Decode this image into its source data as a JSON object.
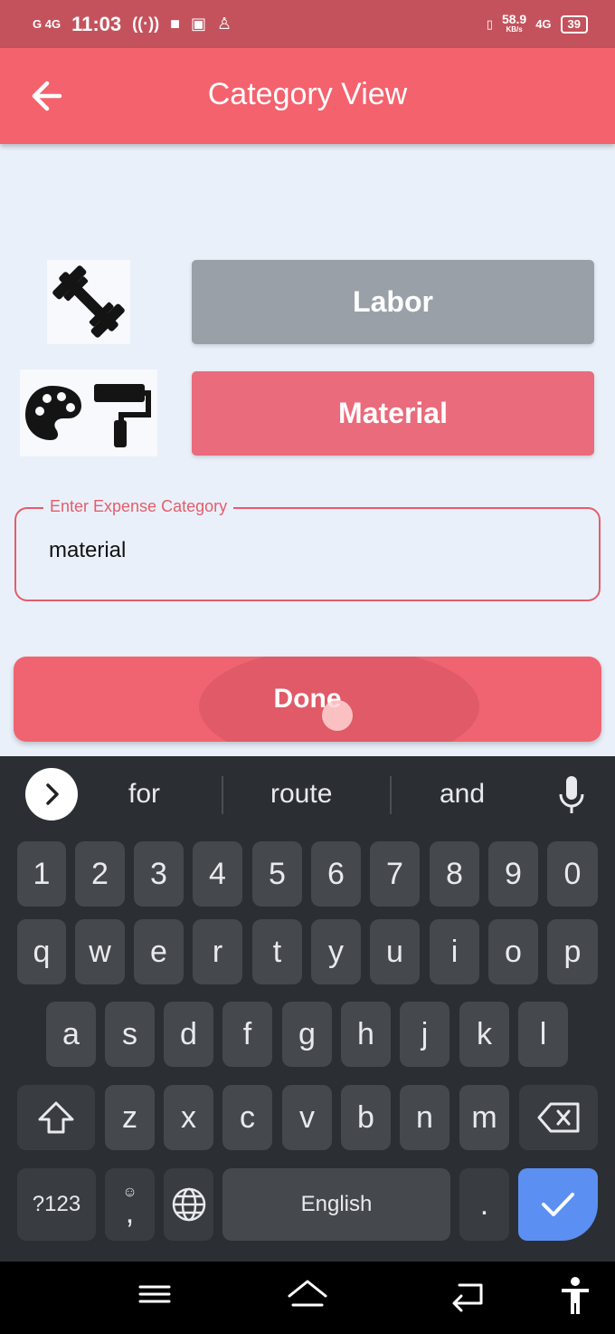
{
  "status_bar": {
    "time": "11:03",
    "signal_text": "G 4G",
    "speed": "58.9",
    "speed_unit": "KB/s",
    "network": "4G",
    "battery": "39"
  },
  "app_bar": {
    "title": "Category View"
  },
  "categories": [
    {
      "label": "Labor",
      "color": "#9aa0a8",
      "icon": "dumbbell-icon"
    },
    {
      "label": "Material",
      "color": "#ea6b7c",
      "icon": "palette-paint-roller-icon"
    }
  ],
  "expense_field": {
    "label": "Enter Expense Category",
    "value": "material"
  },
  "done_button": {
    "label": "Done"
  },
  "keyboard": {
    "suggestions": [
      "for",
      "route",
      "and"
    ],
    "number_row": [
      "1",
      "2",
      "3",
      "4",
      "5",
      "6",
      "7",
      "8",
      "9",
      "0"
    ],
    "row1": [
      "q",
      "w",
      "e",
      "r",
      "t",
      "y",
      "u",
      "i",
      "o",
      "p"
    ],
    "row2": [
      "a",
      "s",
      "d",
      "f",
      "g",
      "h",
      "j",
      "k",
      "l"
    ],
    "row3": [
      "z",
      "x",
      "c",
      "v",
      "b",
      "n",
      "m"
    ],
    "symbols_label": "?123",
    "comma": ",",
    "space_label": "English",
    "period": "."
  },
  "colors": {
    "accent": "#f4626d",
    "status_bar": "#c4525c",
    "keyboard_bg": "#2b2f33",
    "key": "#45494d",
    "enter": "#5b8ff2"
  }
}
